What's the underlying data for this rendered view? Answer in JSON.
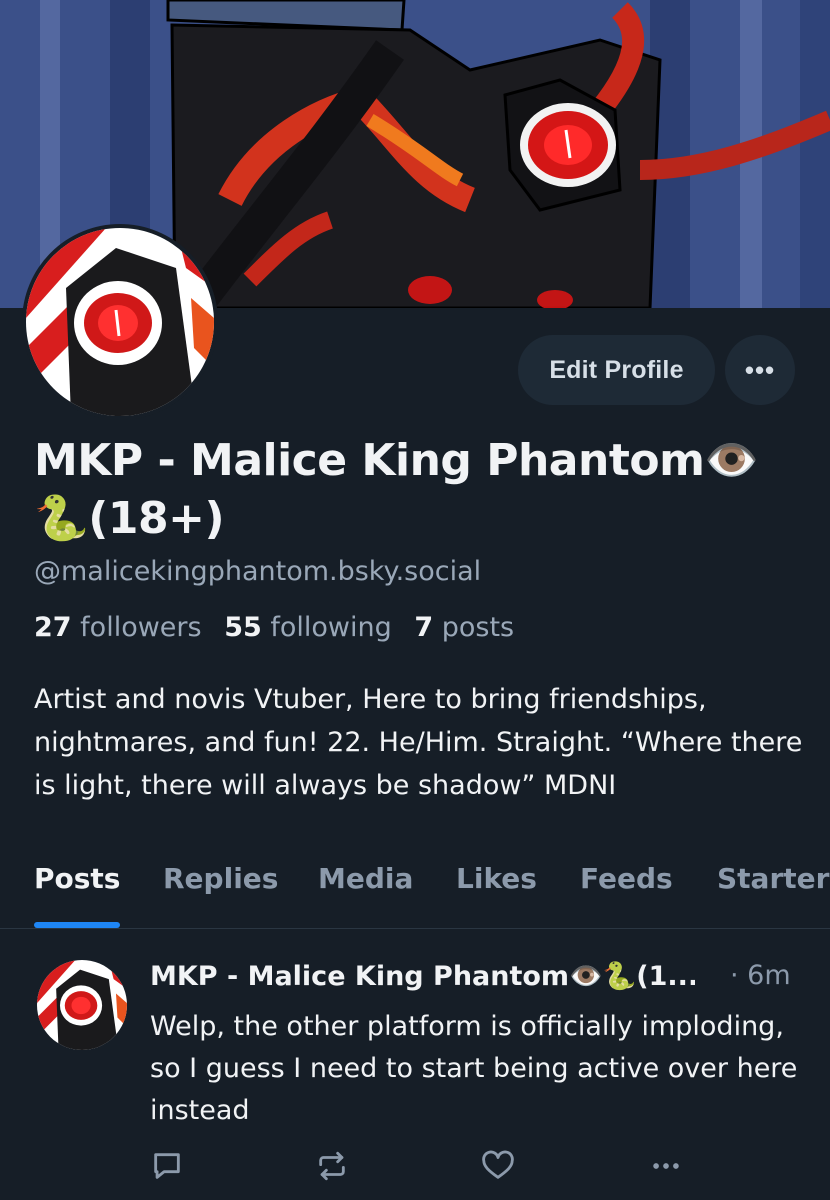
{
  "profile": {
    "name_line1": "MKP - Malice King Phantom👁️",
    "name_line2": "🐍(18+)",
    "handle": "@malicekingphantom.bsky.social",
    "stats": {
      "followers_count": "27",
      "followers_label": "followers",
      "following_count": "55",
      "following_label": "following",
      "posts_count": "7",
      "posts_label": "posts"
    },
    "bio": "Artist and novis Vtuber, Here to bring friendships, nightmares, and fun! 22. He/Him. Straight. “Where there is light, there will always be shadow” MDNI"
  },
  "actions": {
    "edit_label": "Edit Profile",
    "more_label": "•••"
  },
  "tabs": [
    {
      "label": "Posts",
      "active": true
    },
    {
      "label": "Replies"
    },
    {
      "label": "Media"
    },
    {
      "label": "Likes"
    },
    {
      "label": "Feeds"
    },
    {
      "label": "Starter"
    }
  ],
  "post": {
    "author": "MKP - Malice King Phantom👁️🐍(1...",
    "time": "· 6m",
    "text": "Welp, the other platform is officially imploding, so I guess I need to start being active over here instead"
  },
  "icons": {
    "reply": "reply-icon",
    "repost": "repost-icon",
    "like": "heart-icon",
    "more": "more-icon"
  },
  "colors": {
    "background": "#161e27",
    "accent": "#1e86f5",
    "muted_text": "#8c9aab",
    "button_bg": "#1e2a36"
  }
}
